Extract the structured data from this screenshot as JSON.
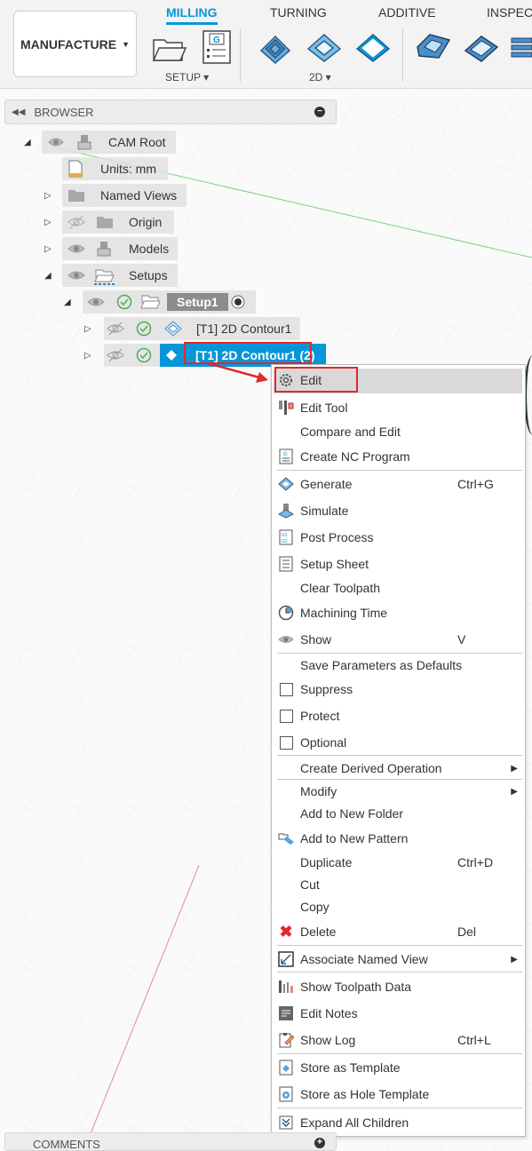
{
  "toolbar": {
    "workspace_label": "MANUFACTURE",
    "tabs": [
      "MILLING",
      "TURNING",
      "ADDITIVE",
      "INSPEC"
    ],
    "active_tab": "MILLING",
    "setup_label": "SETUP",
    "twod_label": "2D",
    "accent": "#0696d7"
  },
  "browser": {
    "title": "BROWSER",
    "cam_root": "CAM Root",
    "units": "Units: mm",
    "named_views": "Named Views",
    "origin": "Origin",
    "models": "Models",
    "setups": "Setups",
    "setup1": "Setup1",
    "op1": "[T1] 2D Contour1",
    "op2": "[T1] 2D Contour1 (2)"
  },
  "context_menu": {
    "items": [
      {
        "label": "Edit",
        "icon": "gear-icon"
      },
      {
        "label": "Edit Tool",
        "icon": "edit-tool-icon"
      },
      {
        "label": "Compare and Edit"
      },
      {
        "label": "Create NC Program",
        "icon": "nc-program-icon"
      },
      {
        "label": "Generate",
        "shortcut": "Ctrl+G",
        "icon": "generate-icon"
      },
      {
        "label": "Simulate",
        "icon": "simulate-icon"
      },
      {
        "label": "Post Process",
        "icon": "post-process-icon"
      },
      {
        "label": "Setup Sheet",
        "icon": "setup-sheet-icon"
      },
      {
        "label": "Clear Toolpath"
      },
      {
        "label": "Machining Time",
        "icon": "clock-icon"
      },
      {
        "label": "Show",
        "shortcut": "V",
        "icon": "eye-icon"
      },
      {
        "label": "Save Parameters as Defaults"
      },
      {
        "label": "Suppress",
        "icon": "checkbox-icon"
      },
      {
        "label": "Protect",
        "icon": "checkbox-icon"
      },
      {
        "label": "Optional",
        "icon": "checkbox-icon"
      },
      {
        "label": "Create Derived Operation"
      },
      {
        "label": "Modify"
      },
      {
        "label": "Add to New Folder"
      },
      {
        "label": "Add to New Pattern",
        "icon": "pattern-icon"
      },
      {
        "label": "Duplicate",
        "shortcut": "Ctrl+D"
      },
      {
        "label": "Cut"
      },
      {
        "label": "Copy"
      },
      {
        "label": "Delete",
        "shortcut": "Del",
        "icon": "delete-icon"
      },
      {
        "label": "Associate Named View",
        "icon": "named-view-icon"
      },
      {
        "label": "Show Toolpath Data",
        "icon": "toolpath-data-icon"
      },
      {
        "label": "Edit Notes",
        "icon": "notes-icon"
      },
      {
        "label": "Show Log",
        "shortcut": "Ctrl+L",
        "icon": "log-icon"
      },
      {
        "label": "Store as Template",
        "icon": "template-icon"
      },
      {
        "label": "Store as Hole Template",
        "icon": "hole-template-icon"
      },
      {
        "label": "Expand All Children",
        "icon": "expand-icon"
      }
    ]
  },
  "comments": {
    "title": "COMMENTS"
  }
}
